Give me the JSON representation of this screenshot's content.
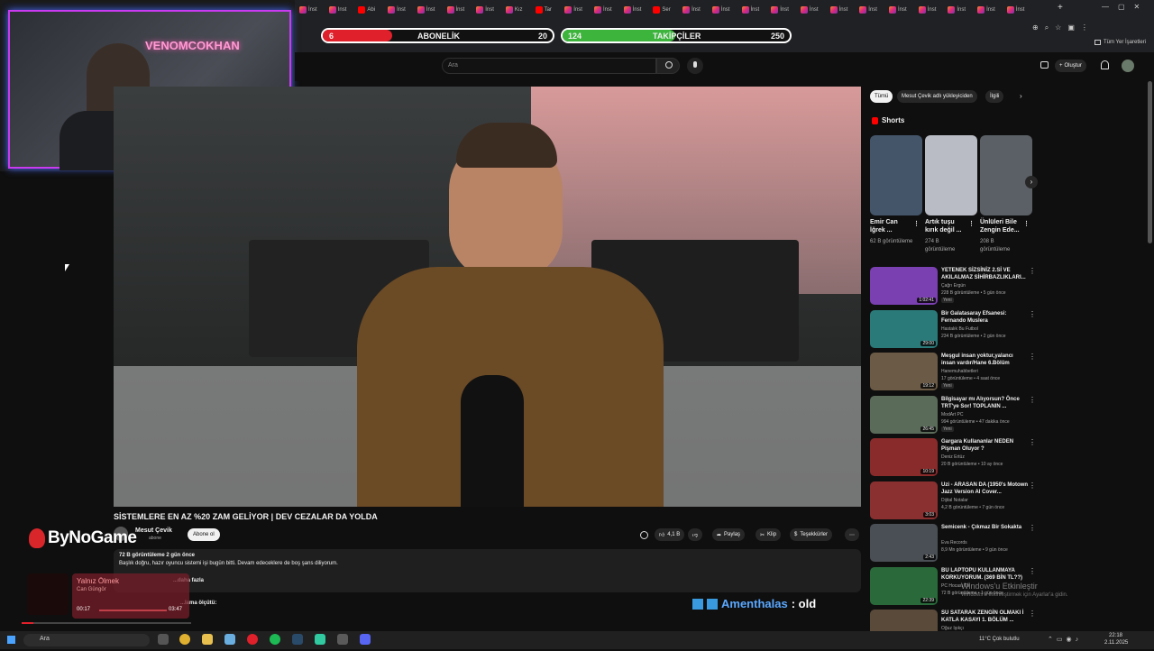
{
  "browser": {
    "tabs": [
      {
        "label": "İnst",
        "icon": "instagram-icon"
      },
      {
        "label": "Inst",
        "icon": "instagram-icon"
      },
      {
        "label": "Abi",
        "icon": "youtube-icon"
      },
      {
        "label": "İnst",
        "icon": "instagram-icon"
      },
      {
        "label": "İnst",
        "icon": "instagram-icon"
      },
      {
        "label": "İnst",
        "icon": "instagram-icon"
      },
      {
        "label": "İnst",
        "icon": "instagram-icon"
      },
      {
        "label": "Kız",
        "icon": "instagram-icon"
      },
      {
        "label": "Tar",
        "icon": "youtube-icon"
      },
      {
        "label": "İnst",
        "icon": "instagram-icon"
      },
      {
        "label": "İnst",
        "icon": "instagram-icon"
      },
      {
        "label": "İnst",
        "icon": "instagram-icon"
      },
      {
        "label": "Ser",
        "icon": "youtube-icon"
      },
      {
        "label": "İnst",
        "icon": "instagram-icon"
      },
      {
        "label": "İnst",
        "icon": "instagram-icon"
      },
      {
        "label": "İnst",
        "icon": "instagram-icon"
      },
      {
        "label": "İnst",
        "icon": "instagram-icon"
      },
      {
        "label": "İnst",
        "icon": "instagram-icon"
      },
      {
        "label": "İnst",
        "icon": "instagram-icon"
      },
      {
        "label": "İnst",
        "icon": "instagram-icon"
      },
      {
        "label": "İnst",
        "icon": "instagram-icon"
      },
      {
        "label": "İnst",
        "icon": "instagram-icon"
      },
      {
        "label": "İnst",
        "icon": "instagram-icon"
      },
      {
        "label": "İnst",
        "icon": "instagram-icon"
      },
      {
        "label": "İnst",
        "icon": "instagram-icon"
      }
    ],
    "new_tab": "+",
    "bookmarks_label": "Tüm Yer İşaretleri"
  },
  "overlay": {
    "subscribers": {
      "current": "6",
      "label": "ABONELİK",
      "goal": "20",
      "color": "#e0202a"
    },
    "followers": {
      "current": "124",
      "label": "TAKİPÇİLER",
      "goal": "250",
      "color": "#3db53d"
    },
    "webcam_sign": "VENOMCOKHAN",
    "brand": "ByNoGame",
    "music": {
      "title": "Yalnız Ölmek",
      "artist": "Can Güngör",
      "elapsed": "00:17",
      "total": "03:47",
      "progress": 0.07
    },
    "chat": {
      "user": "Amenthalas",
      "message": ": old"
    },
    "activation": {
      "title": "Windows'u Etkinleştir",
      "subtitle": "Windows'u etkinleştirmek için Ayarlar'a gidin."
    }
  },
  "youtube": {
    "search_placeholder": "Ara",
    "create_label": "Oluştur",
    "video_title": "SİSTEMLERE EN AZ %20 ZAM GELİYOR | DEV CEZALAR DA YOLDA",
    "channel": "Mesut Çevik",
    "channel_subs": "abone",
    "subscribe": "Abone ol",
    "likes": "4,1 B",
    "share": "Paylaş",
    "clip": "Klip",
    "thanks": "Teşekkürler",
    "more": "⋯",
    "desc_meta": "72 B görüntüleme  2 gün önce",
    "desc_text": "Başlık doğru, hazır oyuncu sistemi işi bugün bitti. Devam edeceklere de boş şans diliyorum.",
    "desc_more": "...daha fazla",
    "desc_line2": "...lama ölçütü:",
    "chips": [
      {
        "label": "Tümü",
        "active": true
      },
      {
        "label": "Mesut Çevik adlı yükleyiciden",
        "active": false
      },
      {
        "label": "İlgili",
        "active": false
      }
    ],
    "shorts_title": "Shorts",
    "shorts": [
      {
        "title": "Emir Can İğrek ...",
        "views": "62 B görüntüleme",
        "color": "#44556a"
      },
      {
        "title": "Artık tuşu kırık değil ...",
        "views": "274 B görüntüleme",
        "color": "#b9bcc4"
      },
      {
        "title": "Ünlüleri Bile Zengin Ede...",
        "views": "208 B görüntüleme",
        "color": "#5a6066"
      }
    ],
    "recommendations": [
      {
        "title": "YETENEK SİZSİNİZ 2.Sİ VE AKILALMAZ SİHİRBAZLIKLARI...",
        "channel": "Çağrı Ergün",
        "views": "228 B görüntüleme • 5 gün önce",
        "duration": "1:02:41",
        "new": "Yeni",
        "color": "#7a3fb0"
      },
      {
        "title": "Bir Galatasaray Efsanesi: Fernando Muslera",
        "channel": "Hastalık Bu Futbol",
        "views": "234 B görüntüleme • 2 gün önce",
        "duration": "29:00",
        "new": "",
        "color": "#2b7a7a"
      },
      {
        "title": "Meşgul insan yoktur,yalancı insan vardır/Hane 6.Bölüm",
        "channel": "Hanemuhabbetleri",
        "views": "17 görüntüleme • 4 saat önce",
        "duration": "19:12",
        "new": "Yeni",
        "color": "#6b5a45"
      },
      {
        "title": "Bilgisayar mı Alıyorsun? Önce TRT'ye Sor! TOPLANIN ...",
        "channel": "ModArt PC",
        "views": "994 görüntüleme • 47 dakika önce",
        "duration": "26:45",
        "new": "Yeni",
        "color": "#5b6b5a"
      },
      {
        "title": "Gargara Kullananlar NEDEN Pişman Oluyor ?",
        "channel": "Deniz Ertüz",
        "views": "20 B görüntüleme • 10 ay önce",
        "duration": "10:19",
        "new": "",
        "color": "#8a2b2b"
      },
      {
        "title": "Uzi - ARASAN DA (1950's Motown Jazz Version AI Cover...",
        "channel": "Dijital Notalar",
        "views": "4,2 B görüntüleme • 7 gün önce",
        "duration": "3:03",
        "new": "",
        "color": "#8a3030"
      },
      {
        "title": "Semicenk - Çıkmaz Bir Sokakta",
        "channel": "Eva Records",
        "views": "8,9 Mn görüntüleme • 9 gün önce",
        "duration": "2:43",
        "new": "",
        "color": "#4a4f55"
      },
      {
        "title": "BU LAPTOPU KULLANMAYA KORKUYORUM. (369 BİN TL??)",
        "channel": "PC Hocası TV",
        "views": "72 B görüntüleme • 1 gün önce",
        "duration": "22:39",
        "new": "",
        "color": "#2a6a3a"
      },
      {
        "title": "SU SATARAK ZENGİN OLMAKI İ KATLA KASAYI 1. BÖLÜM ...",
        "channel": "Oğuz Işıkçı",
        "views": "",
        "duration": "",
        "new": "",
        "color": "#5a4a3a"
      }
    ]
  },
  "taskbar": {
    "search": "Ara",
    "weather": "11°C  Çok bulutlu",
    "time": "22:18",
    "date": "2.11.2025"
  }
}
